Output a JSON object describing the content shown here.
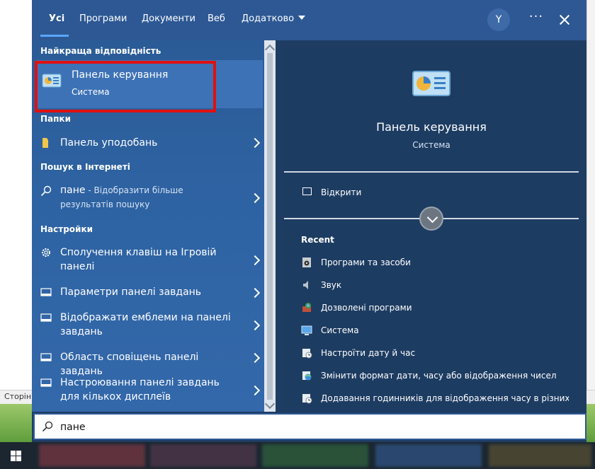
{
  "header": {
    "tabs": [
      {
        "label": "Усі"
      },
      {
        "label": "Програми"
      },
      {
        "label": "Документи"
      },
      {
        "label": "Веб"
      },
      {
        "label": "Додатково"
      }
    ],
    "avatar_initial": "Y",
    "more_label": "···"
  },
  "results": {
    "best_match_heading": "Найкраща відповідність",
    "best_match": {
      "title": "Панель керування",
      "subtitle": "Система"
    },
    "folders_heading": "Папки",
    "folders": [
      {
        "label": "Панель уподобань"
      }
    ],
    "web_heading": "Пошук в Інтернеті",
    "web": {
      "query": "пане",
      "suffix": " - Відобразити більше результатів пошуку"
    },
    "settings_heading": "Настройки",
    "settings": [
      {
        "label": "Сполучення клавіш на Ігровій панелі"
      },
      {
        "label": "Параметри панелі завдань"
      },
      {
        "label": "Відображати емблеми на панелі завдань"
      },
      {
        "label": "Область сповіщень панелі завдань"
      },
      {
        "label": "Настроювання панелі завдань для кількох дисплеїв"
      }
    ]
  },
  "detail": {
    "title": "Панель керування",
    "subtitle": "Система",
    "open_label": "Відкрити",
    "recent_heading": "Recent",
    "recent": [
      {
        "label": "Програми та засоби",
        "icon": "programs-icon"
      },
      {
        "label": "Звук",
        "icon": "speaker-icon"
      },
      {
        "label": "Дозволені програми",
        "icon": "firewall-icon"
      },
      {
        "label": "Система",
        "icon": "system-icon"
      },
      {
        "label": "Настроїти дату й час",
        "icon": "clock-icon"
      },
      {
        "label": "Змінити формат дати, часу або відображення чисел",
        "icon": "region-icon"
      },
      {
        "label": "Додавання годинників для відображення часу в різних…",
        "icon": "clock-icon"
      }
    ]
  },
  "search": {
    "value": "пане"
  },
  "background": {
    "status_text": "Сторін"
  },
  "colors": {
    "header": "#2d5894",
    "panel": "#1d3c62",
    "highlight_border": "#e01010",
    "accent": "#5aa7ff"
  }
}
